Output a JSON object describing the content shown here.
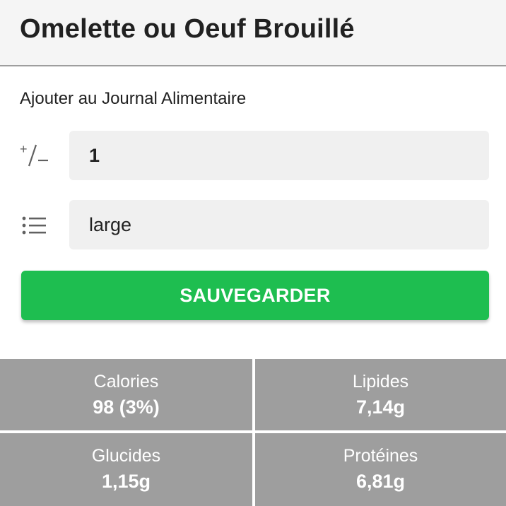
{
  "header": {
    "title": "Omelette ou Oeuf Brouillé"
  },
  "form": {
    "section_label": "Ajouter au Journal Alimentaire",
    "quantity": {
      "icon": "plus-minus-icon",
      "icon_text": "+/–",
      "value": "1"
    },
    "unit": {
      "icon": "list-icon",
      "value": "large"
    },
    "save_label": "SAUVEGARDER"
  },
  "nutrition": {
    "calories": {
      "label": "Calories",
      "value": "98 (3%)"
    },
    "lipides": {
      "label": "Lipides",
      "value": "7,14g"
    },
    "glucides": {
      "label": "Glucides",
      "value": "1,15g"
    },
    "proteines": {
      "label": "Protéines",
      "value": "6,81g"
    }
  },
  "colors": {
    "accent": "#1ebe50",
    "grid_cell": "#9e9e9e",
    "field_bg": "#f0f0f0",
    "header_bg": "#f5f5f5"
  }
}
